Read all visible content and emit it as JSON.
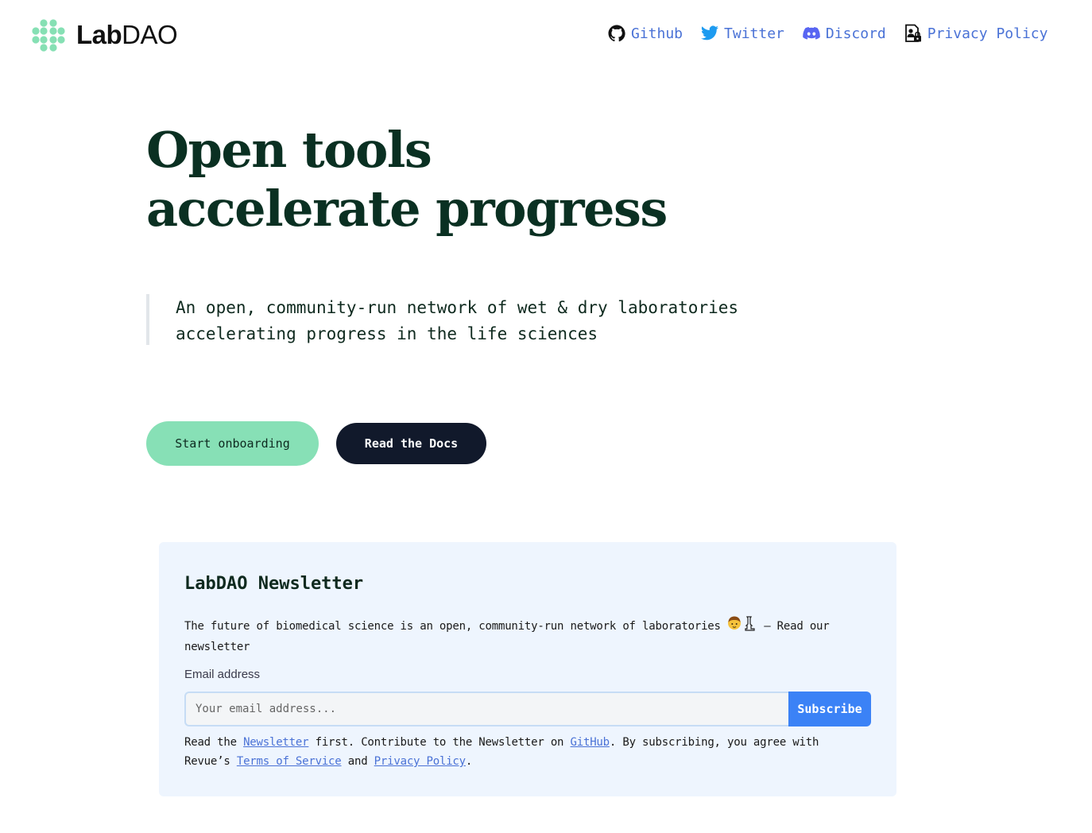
{
  "header": {
    "logo": {
      "bold": "Lab",
      "light": "DAO",
      "color": "#86e0b4"
    },
    "nav": [
      {
        "label": "Github",
        "icon": "github-icon"
      },
      {
        "label": "Twitter",
        "icon": "twitter-icon"
      },
      {
        "label": "Discord",
        "icon": "discord-icon"
      },
      {
        "label": "Privacy Policy",
        "icon": "privacy-document-icon"
      }
    ]
  },
  "hero": {
    "title_line1": "Open tools",
    "title_line2": "accelerate progress",
    "tagline_line1": "An open, community-run network of wet & dry laboratories",
    "tagline_line2": "accelerating progress in the life sciences",
    "primary_button": "Start onboarding",
    "secondary_button": "Read the Docs"
  },
  "newsletter": {
    "title": "LabDAO Newsletter",
    "description_before": "The future of biomedical science is an open, community-run network of laboratories",
    "emoji": "🧑‍🔬",
    "description_after": " — Read our newsletter",
    "email_label": "Email address",
    "email_placeholder": "Your email address...",
    "email_value": "",
    "subscribe_label": "Subscribe",
    "footer": {
      "t1": "Read the ",
      "link_newsletter": "Newsletter",
      "t2": " first. Contribute to the Newsletter on ",
      "link_github": "GitHub",
      "t3": ". By subscribing, you agree with Revue’s ",
      "link_terms": "Terms of Service",
      "t4": " and ",
      "link_privacy": "Privacy Policy",
      "t5": "."
    }
  },
  "colors": {
    "accent_green": "#87e0b6",
    "dark_navy": "#11192b",
    "link_blue": "#4a72d6",
    "subscribe_blue": "#3b82f6",
    "heading_green": "#0a3022",
    "newsletter_bg": "#eef5fe"
  }
}
